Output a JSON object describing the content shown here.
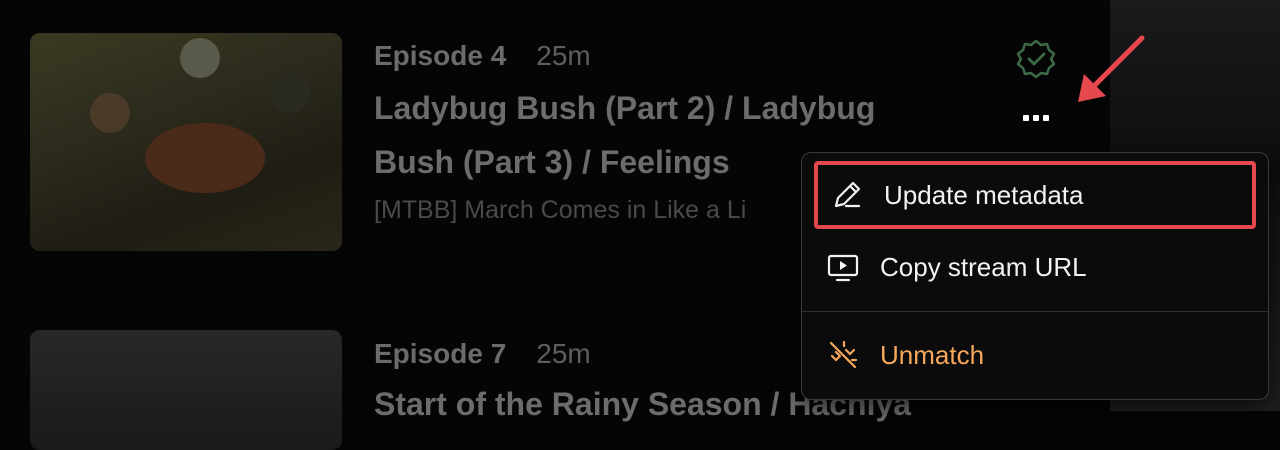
{
  "episodes": [
    {
      "number_label": "Episode 4",
      "duration": "25m",
      "title_line1": "Ladybug Bush (Part 2) / Ladybug",
      "title_line2": "Bush (Part 3) / Feelings",
      "file_name": "[MTBB] March Comes in Like a Li"
    },
    {
      "number_label": "Episode 7",
      "duration": "25m",
      "title_line1": "Start of the Rainy Season / Hachiya"
    }
  ],
  "badge_icon": "verified-check-icon",
  "more_icon": "ellipsis-icon",
  "menu": {
    "items": [
      {
        "label": "Update metadata",
        "icon": "pencil-icon"
      },
      {
        "label": "Copy stream URL",
        "icon": "screen-play-icon"
      },
      {
        "label": "Unmatch",
        "icon": "unlink-icon"
      }
    ]
  },
  "colors": {
    "highlight": "#e5484d",
    "badge": "#3d6b47",
    "danger_text": "#f5a85b"
  }
}
